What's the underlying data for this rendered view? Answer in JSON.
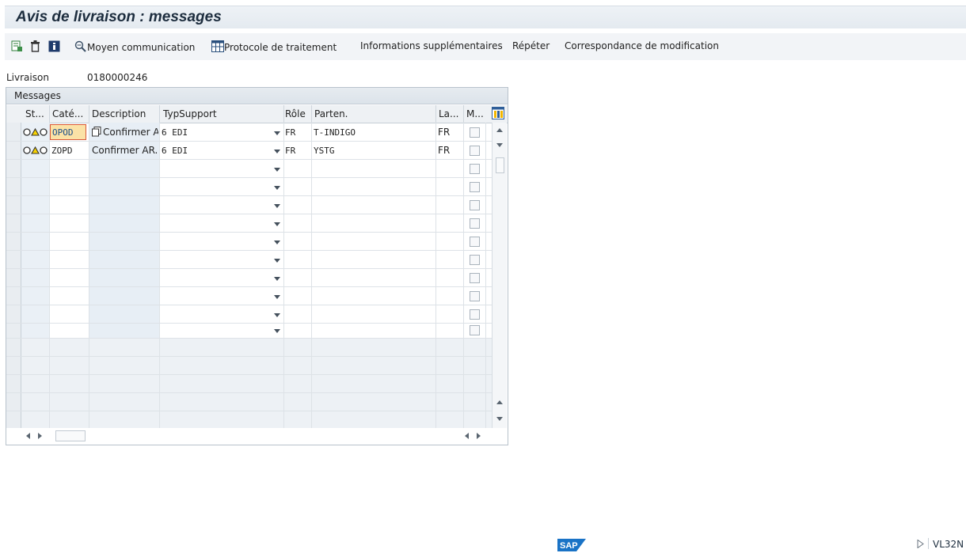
{
  "window": {
    "title": "Avis de livraison : messages"
  },
  "toolbar": {
    "items": [
      {
        "icon": "detail-icon",
        "label": ""
      },
      {
        "icon": "trash-icon",
        "label": ""
      },
      {
        "icon": "info-icon",
        "label": ""
      },
      {
        "icon": "magnify-communication-icon",
        "label": "Moyen communication"
      },
      {
        "icon": "table-grid-icon",
        "label": "Protocole de traitement"
      },
      {
        "icon": "",
        "label": "Informations supplémentaires"
      },
      {
        "icon": "",
        "label": "Répéter"
      },
      {
        "icon": "",
        "label": "Correspondance de modification"
      }
    ]
  },
  "delivery": {
    "label": "Livraison",
    "value": "0180000246"
  },
  "grid": {
    "title": "Messages",
    "headers": [
      "St...",
      "Caté...",
      "Description",
      "TypSupport",
      "Rôle",
      "Parten.",
      "La...",
      "M..."
    ],
    "rows": [
      {
        "status_icons": "traffic-light-icon",
        "category": "OPOD",
        "description": "Confirmer ARL",
        "support": "6 EDI",
        "role": "FR",
        "partner": "T-INDIGO",
        "language": "FR",
        "selected": true
      },
      {
        "status_icons": "traffic-light-icon",
        "category": "ZOPD",
        "description": "Confirmer AR...",
        "support": "6 EDI",
        "role": "FR",
        "partner": "YSTG",
        "language": "FR",
        "selected": false
      }
    ]
  },
  "statusbar": {
    "logo": "SAP",
    "transaction": "VL32N"
  },
  "colors": {
    "accent": "#f0c26a",
    "title": "#1d2d3e",
    "sap_blue": "#1a73c6"
  }
}
